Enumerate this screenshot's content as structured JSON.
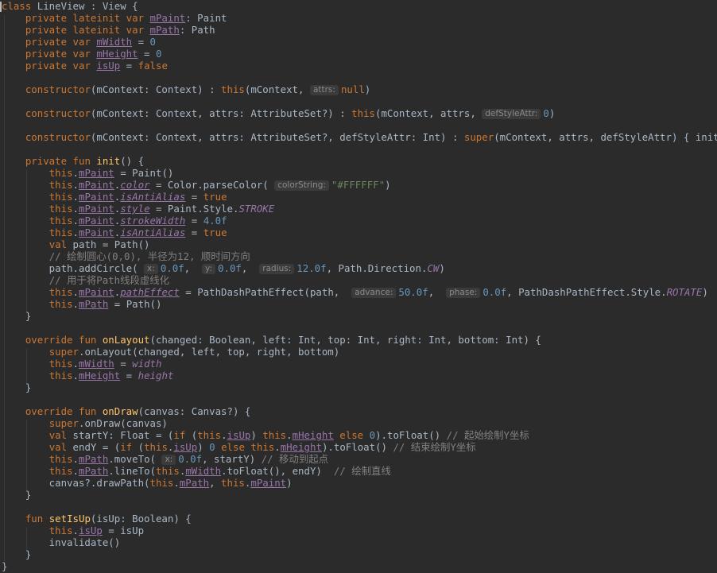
{
  "editor": {
    "colors": {
      "background": "#2b2b2b",
      "keyword": "#cc7832",
      "function": "#ffc66d",
      "string": "#6a8759",
      "number": "#6897bb",
      "field": "#9876aa",
      "comment": "#808080",
      "text": "#a9b7c6"
    },
    "lines": [
      [
        [
          "kw",
          "class "
        ],
        [
          "t",
          "LineView : View {"
        ]
      ],
      [
        [
          "t",
          "    "
        ],
        [
          "kw",
          "private lateinit var "
        ],
        [
          "ufld",
          "mPaint"
        ],
        [
          "t",
          ": Paint"
        ]
      ],
      [
        [
          "t",
          "    "
        ],
        [
          "kw",
          "private lateinit var "
        ],
        [
          "ufld",
          "mPath"
        ],
        [
          "t",
          ": Path"
        ]
      ],
      [
        [
          "t",
          "    "
        ],
        [
          "kw",
          "private var "
        ],
        [
          "ufld",
          "mWidth"
        ],
        [
          "t",
          " = "
        ],
        [
          "num",
          "0"
        ]
      ],
      [
        [
          "t",
          "    "
        ],
        [
          "kw",
          "private var "
        ],
        [
          "ufld",
          "mHeight"
        ],
        [
          "t",
          " = "
        ],
        [
          "num",
          "0"
        ]
      ],
      [
        [
          "t",
          "    "
        ],
        [
          "kw",
          "private var "
        ],
        [
          "ufld",
          "isUp"
        ],
        [
          "t",
          " = "
        ],
        [
          "kw",
          "false"
        ]
      ],
      [],
      [
        [
          "t",
          "    "
        ],
        [
          "kw",
          "constructor"
        ],
        [
          "t",
          "(mContext: Context) : "
        ],
        [
          "kw",
          "this"
        ],
        [
          "t",
          "(mContext, "
        ],
        [
          "hint",
          "attrs:"
        ],
        [
          "kw",
          "null"
        ],
        [
          "t",
          ")"
        ]
      ],
      [],
      [
        [
          "t",
          "    "
        ],
        [
          "kw",
          "constructor"
        ],
        [
          "t",
          "(mContext: Context, attrs: AttributeSet?) : "
        ],
        [
          "kw",
          "this"
        ],
        [
          "t",
          "(mContext, attrs, "
        ],
        [
          "hint",
          "defStyleAttr:"
        ],
        [
          "num",
          "0"
        ],
        [
          "t",
          ")"
        ]
      ],
      [],
      [
        [
          "t",
          "    "
        ],
        [
          "kw",
          "constructor"
        ],
        [
          "t",
          "(mContext: Context, attrs: AttributeSet?, defStyleAttr: Int) : "
        ],
        [
          "kw",
          "super"
        ],
        [
          "t",
          "(mContext, attrs, defStyleAttr) { init() }"
        ]
      ],
      [],
      [
        [
          "t",
          "    "
        ],
        [
          "kw",
          "private fun "
        ],
        [
          "fn",
          "init"
        ],
        [
          "t",
          "() {"
        ]
      ],
      [
        [
          "t",
          "        "
        ],
        [
          "kw",
          "this"
        ],
        [
          "t",
          "."
        ],
        [
          "ufld",
          "mPaint"
        ],
        [
          "t",
          " = Paint()"
        ]
      ],
      [
        [
          "t",
          "        "
        ],
        [
          "kw",
          "this"
        ],
        [
          "t",
          "."
        ],
        [
          "ufld",
          "mPaint"
        ],
        [
          "t",
          "."
        ],
        [
          "iu",
          "color"
        ],
        [
          "t",
          " = Color.parseColor( "
        ],
        [
          "hint",
          "colorString:"
        ],
        [
          "str",
          "\"#FFFFFF\""
        ],
        [
          "t",
          ")"
        ]
      ],
      [
        [
          "t",
          "        "
        ],
        [
          "kw",
          "this"
        ],
        [
          "t",
          "."
        ],
        [
          "ufld",
          "mPaint"
        ],
        [
          "t",
          "."
        ],
        [
          "iu",
          "isAntiAlias"
        ],
        [
          "t",
          " = "
        ],
        [
          "kw",
          "true"
        ]
      ],
      [
        [
          "t",
          "        "
        ],
        [
          "kw",
          "this"
        ],
        [
          "t",
          "."
        ],
        [
          "ufld",
          "mPaint"
        ],
        [
          "t",
          "."
        ],
        [
          "iu",
          "style"
        ],
        [
          "t",
          " = Paint.Style."
        ],
        [
          "cst",
          "STROKE"
        ]
      ],
      [
        [
          "t",
          "        "
        ],
        [
          "kw",
          "this"
        ],
        [
          "t",
          "."
        ],
        [
          "ufld",
          "mPaint"
        ],
        [
          "t",
          "."
        ],
        [
          "iu",
          "strokeWidth"
        ],
        [
          "t",
          " = "
        ],
        [
          "num",
          "4.0f"
        ]
      ],
      [
        [
          "t",
          "        "
        ],
        [
          "kw",
          "this"
        ],
        [
          "t",
          "."
        ],
        [
          "ufld",
          "mPaint"
        ],
        [
          "t",
          "."
        ],
        [
          "iu",
          "isAntiAlias"
        ],
        [
          "t",
          " = "
        ],
        [
          "kw",
          "true"
        ]
      ],
      [
        [
          "t",
          "        "
        ],
        [
          "kw",
          "val "
        ],
        [
          "t",
          "path = Path()"
        ]
      ],
      [
        [
          "t",
          "        "
        ],
        [
          "cmt",
          "// 绘制圆心(0,0), 半径为12, 顺时间方向"
        ]
      ],
      [
        [
          "t",
          "        path.addCircle( "
        ],
        [
          "hint",
          "x:"
        ],
        [
          "num",
          "0.0f"
        ],
        [
          "t",
          ",  "
        ],
        [
          "hint",
          "y:"
        ],
        [
          "num",
          "0.0f"
        ],
        [
          "t",
          ",  "
        ],
        [
          "hint",
          "radius:"
        ],
        [
          "num",
          "12.0f"
        ],
        [
          "t",
          ", Path.Direction."
        ],
        [
          "cst",
          "CW"
        ],
        [
          "t",
          ")"
        ]
      ],
      [
        [
          "t",
          "        "
        ],
        [
          "cmt",
          "// 用于将Path线段虚线化"
        ]
      ],
      [
        [
          "t",
          "        "
        ],
        [
          "kw",
          "this"
        ],
        [
          "t",
          "."
        ],
        [
          "ufld",
          "mPaint"
        ],
        [
          "t",
          "."
        ],
        [
          "iu",
          "pathEffect"
        ],
        [
          "t",
          " = PathDashPathEffect(path,  "
        ],
        [
          "hint",
          "advance:"
        ],
        [
          "num",
          "50.0f"
        ],
        [
          "t",
          ",  "
        ],
        [
          "hint",
          "phase:"
        ],
        [
          "num",
          "0.0f"
        ],
        [
          "t",
          ", PathDashPathEffect.Style."
        ],
        [
          "cst",
          "ROTATE"
        ],
        [
          "t",
          ")"
        ]
      ],
      [
        [
          "t",
          "        "
        ],
        [
          "kw",
          "this"
        ],
        [
          "t",
          "."
        ],
        [
          "ufld",
          "mPath"
        ],
        [
          "t",
          " = Path()"
        ]
      ],
      [
        [
          "t",
          "    }"
        ]
      ],
      [],
      [
        [
          "t",
          "    "
        ],
        [
          "kw",
          "override fun "
        ],
        [
          "fn",
          "onLayout"
        ],
        [
          "t",
          "(changed: Boolean, left: Int, top: Int, right: Int, bottom: Int) {"
        ]
      ],
      [
        [
          "t",
          "        "
        ],
        [
          "kw",
          "super"
        ],
        [
          "t",
          ".onLayout(changed, left, top, right, bottom)"
        ]
      ],
      [
        [
          "t",
          "        "
        ],
        [
          "kw",
          "this"
        ],
        [
          "t",
          "."
        ],
        [
          "ufld",
          "mWidth"
        ],
        [
          "t",
          " = "
        ],
        [
          "ital",
          "width"
        ]
      ],
      [
        [
          "t",
          "        "
        ],
        [
          "kw",
          "this"
        ],
        [
          "t",
          "."
        ],
        [
          "ufld",
          "mHeight"
        ],
        [
          "t",
          " = "
        ],
        [
          "ital",
          "height"
        ]
      ],
      [
        [
          "t",
          "    }"
        ]
      ],
      [],
      [
        [
          "t",
          "    "
        ],
        [
          "kw",
          "override fun "
        ],
        [
          "fn",
          "onDraw"
        ],
        [
          "t",
          "(canvas: Canvas?) {"
        ]
      ],
      [
        [
          "t",
          "        "
        ],
        [
          "kw",
          "super"
        ],
        [
          "t",
          ".onDraw(canvas)"
        ]
      ],
      [
        [
          "t",
          "        "
        ],
        [
          "kw",
          "val "
        ],
        [
          "t",
          "startY: Float = ("
        ],
        [
          "kw",
          "if "
        ],
        [
          "t",
          "("
        ],
        [
          "kw",
          "this"
        ],
        [
          "t",
          "."
        ],
        [
          "ufld",
          "isUp"
        ],
        [
          "t",
          ") "
        ],
        [
          "kw",
          "this"
        ],
        [
          "t",
          "."
        ],
        [
          "ufld",
          "mHeight"
        ],
        [
          "t",
          " "
        ],
        [
          "kw",
          "else "
        ],
        [
          "num",
          "0"
        ],
        [
          "t",
          ").toFloat() "
        ],
        [
          "cmt",
          "// 起始绘制Y坐标"
        ]
      ],
      [
        [
          "t",
          "        "
        ],
        [
          "kw",
          "val "
        ],
        [
          "t",
          "endY = ("
        ],
        [
          "kw",
          "if "
        ],
        [
          "t",
          "("
        ],
        [
          "kw",
          "this"
        ],
        [
          "t",
          "."
        ],
        [
          "ufld",
          "isUp"
        ],
        [
          "t",
          ") "
        ],
        [
          "num",
          "0"
        ],
        [
          "t",
          " "
        ],
        [
          "kw",
          "else "
        ],
        [
          "kw",
          "this"
        ],
        [
          "t",
          "."
        ],
        [
          "ufld",
          "mHeight"
        ],
        [
          "t",
          ").toFloat() "
        ],
        [
          "cmt",
          "// 结束绘制Y坐标"
        ]
      ],
      [
        [
          "t",
          "        "
        ],
        [
          "kw",
          "this"
        ],
        [
          "t",
          "."
        ],
        [
          "ufld",
          "mPath"
        ],
        [
          "t",
          ".moveTo( "
        ],
        [
          "hint",
          "x:"
        ],
        [
          "num",
          "0.0f"
        ],
        [
          "t",
          ", startY) "
        ],
        [
          "cmt",
          "// 移动到起点"
        ]
      ],
      [
        [
          "t",
          "        "
        ],
        [
          "kw",
          "this"
        ],
        [
          "t",
          "."
        ],
        [
          "ufld",
          "mPath"
        ],
        [
          "t",
          ".lineTo("
        ],
        [
          "kw",
          "this"
        ],
        [
          "t",
          "."
        ],
        [
          "ufld",
          "mWidth"
        ],
        [
          "t",
          ".toFloat(), endY)  "
        ],
        [
          "cmt",
          "// 绘制直线"
        ]
      ],
      [
        [
          "t",
          "        canvas?.drawPath("
        ],
        [
          "kw",
          "this"
        ],
        [
          "t",
          "."
        ],
        [
          "ufld",
          "mPath"
        ],
        [
          "t",
          ", "
        ],
        [
          "kw",
          "this"
        ],
        [
          "t",
          "."
        ],
        [
          "ufld",
          "mPaint"
        ],
        [
          "t",
          ")"
        ]
      ],
      [
        [
          "t",
          "    }"
        ]
      ],
      [],
      [
        [
          "t",
          "    "
        ],
        [
          "kw",
          "fun "
        ],
        [
          "fn",
          "setIsUp"
        ],
        [
          "t",
          "(isUp: Boolean) {"
        ]
      ],
      [
        [
          "t",
          "        "
        ],
        [
          "kw",
          "this"
        ],
        [
          "t",
          "."
        ],
        [
          "ufld",
          "isUp"
        ],
        [
          "t",
          " = isUp"
        ]
      ],
      [
        [
          "t",
          "        invalidate()"
        ]
      ],
      [
        [
          "t",
          "    }"
        ]
      ],
      [
        [
          "t",
          "}"
        ]
      ]
    ]
  }
}
